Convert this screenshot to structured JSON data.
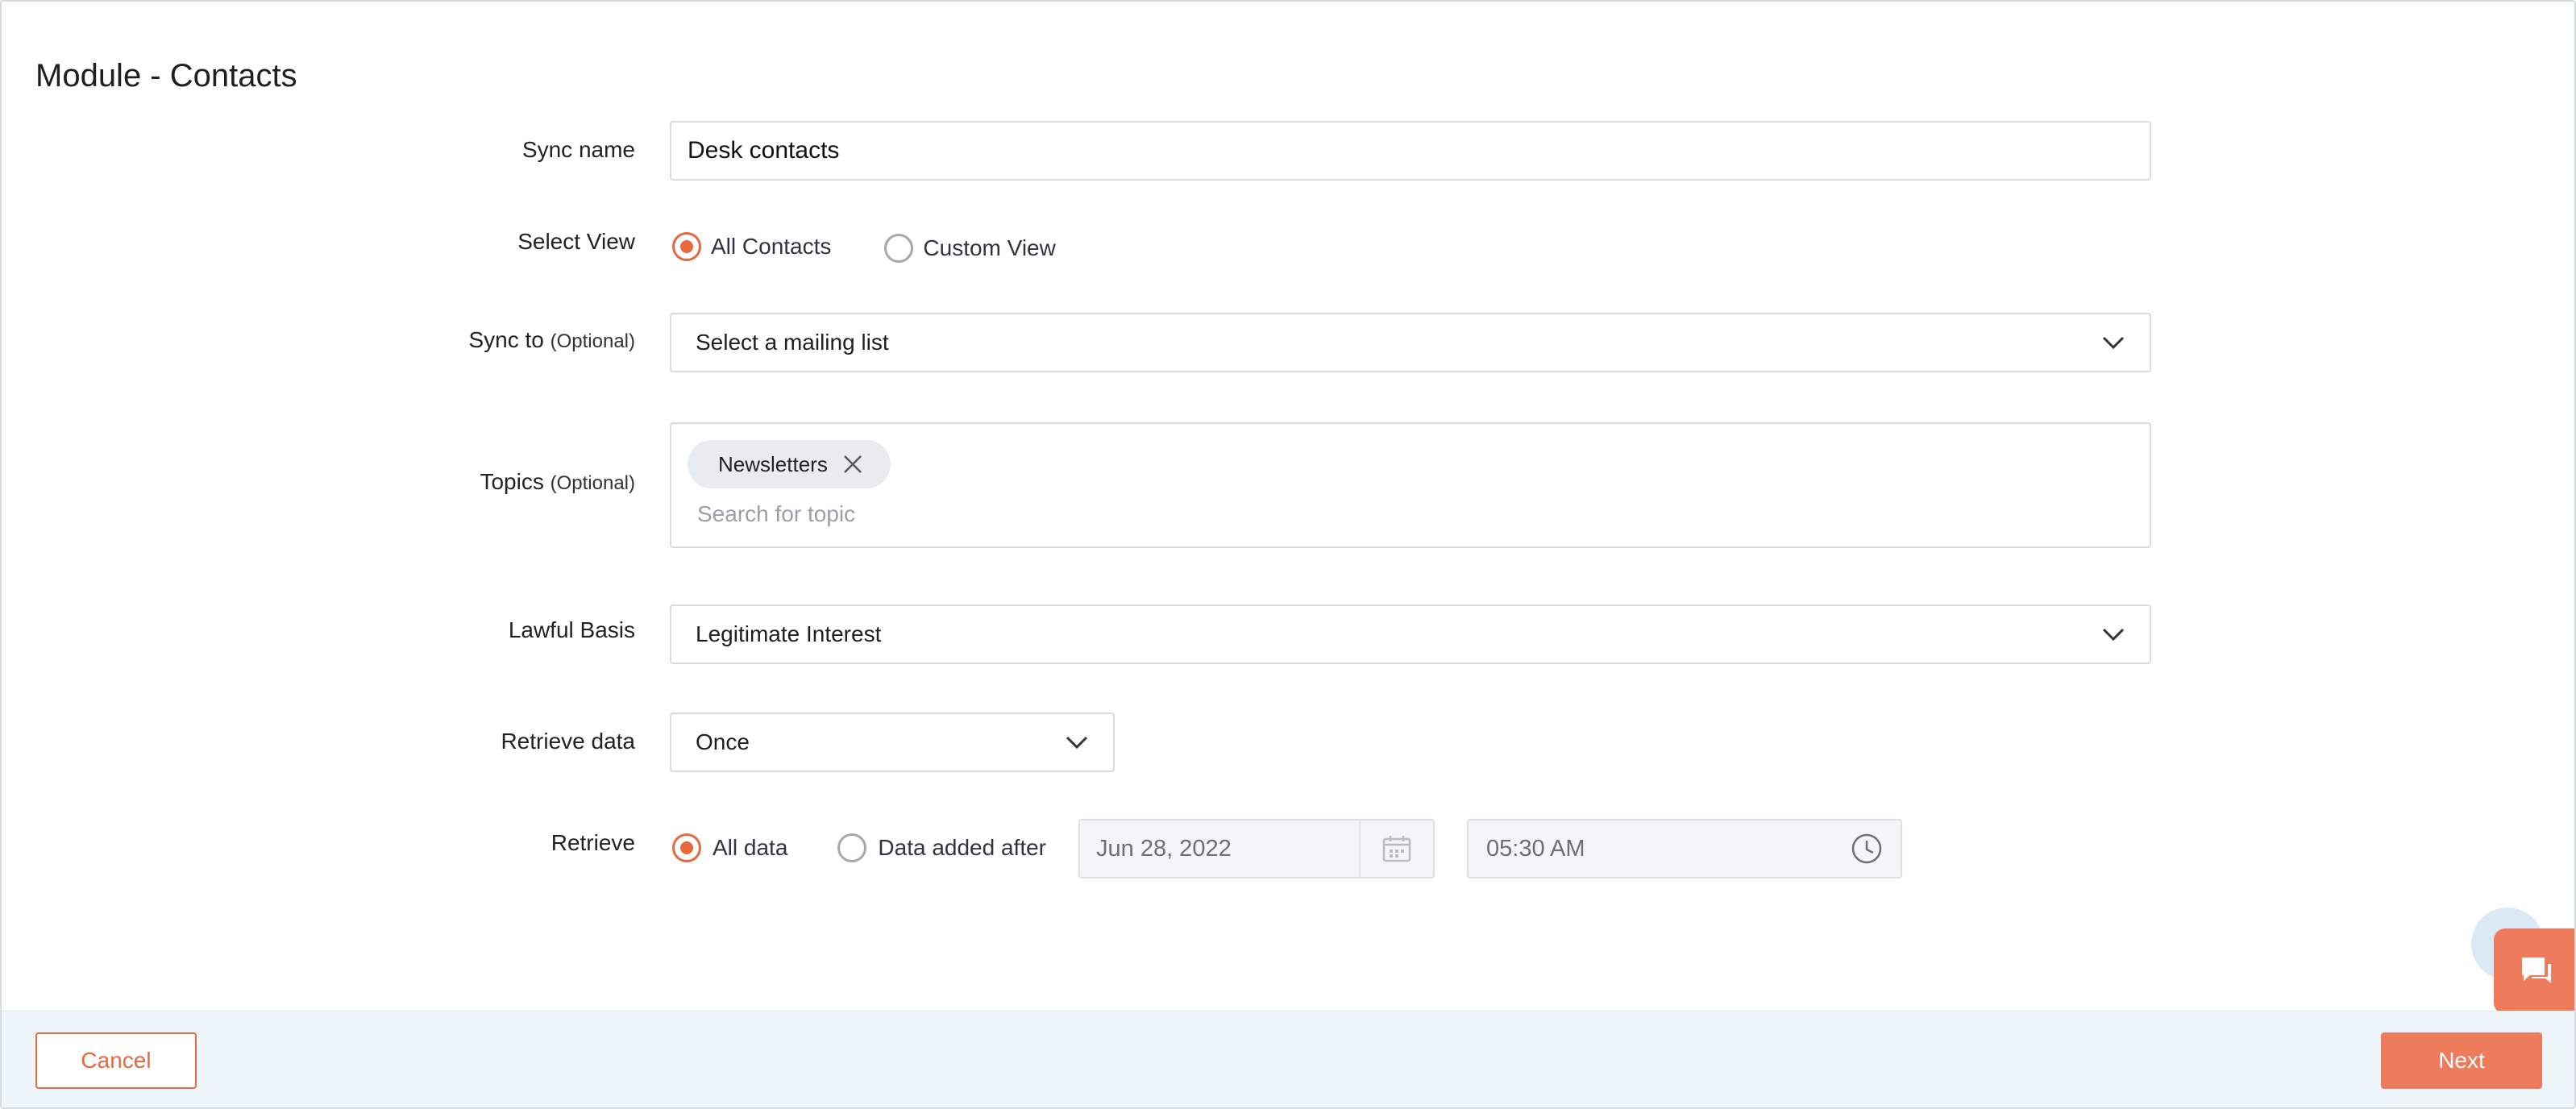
{
  "page": {
    "title": "Module - Contacts"
  },
  "form": {
    "sync_name": {
      "label": "Sync name",
      "value": "Desk contacts"
    },
    "select_view": {
      "label": "Select View",
      "options": [
        {
          "label": "All Contacts",
          "selected": true
        },
        {
          "label": "Custom View",
          "selected": false
        }
      ]
    },
    "sync_to": {
      "label": "Sync to",
      "optional": "(Optional)",
      "value": "Select a mailing list"
    },
    "topics": {
      "label": "Topics",
      "optional": "(Optional)",
      "chips": [
        {
          "label": "Newsletters"
        }
      ],
      "placeholder": "Search for topic"
    },
    "lawful_basis": {
      "label": "Lawful Basis",
      "value": "Legitimate Interest"
    },
    "retrieve_data": {
      "label": "Retrieve data",
      "value": "Once"
    },
    "retrieve": {
      "label": "Retrieve",
      "options": [
        {
          "label": "All data",
          "selected": true
        },
        {
          "label": "Data added after",
          "selected": false
        }
      ],
      "date": "Jun 28, 2022",
      "time": "05:30 AM"
    }
  },
  "footer": {
    "cancel_label": "Cancel",
    "next_label": "Next"
  },
  "icons": {
    "dropdown": "chevron-down-icon",
    "chip_remove": "close-icon",
    "date": "calendar-icon",
    "time": "clock-icon",
    "chat": "chat-icon"
  },
  "colors": {
    "accent": "#e8683e",
    "primary_button": "#ee7b5c",
    "footer_bg": "#eef6fb"
  }
}
